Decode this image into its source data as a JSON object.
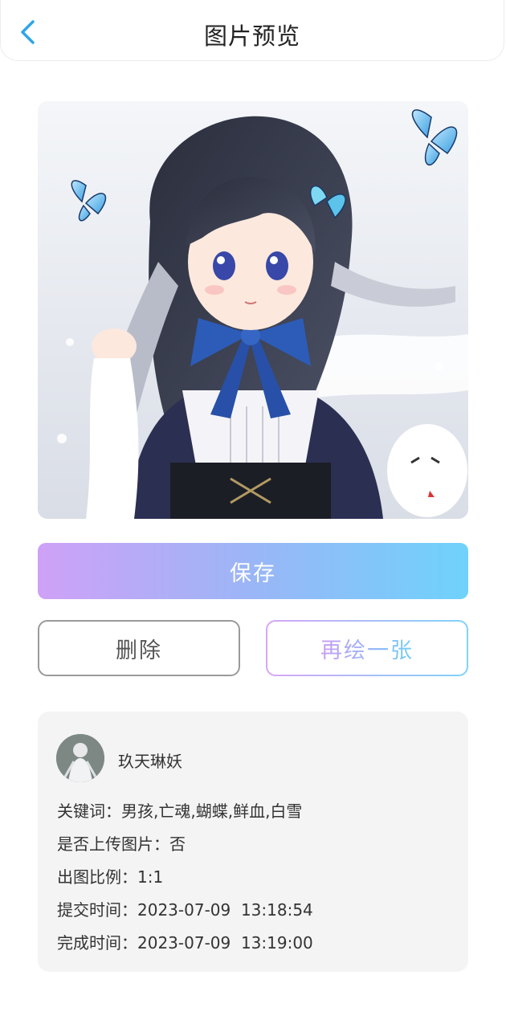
{
  "header": {
    "title": "图片预览"
  },
  "actions": {
    "save_label": "保存",
    "delete_label": "删除",
    "redraw_label": "再绘一张"
  },
  "info": {
    "username": "玖天琳妖",
    "rows": [
      {
        "label": "关键词：",
        "value": "男孩,亡魂,蝴蝶,鲜血,白雪"
      },
      {
        "label": "是否上传图片：",
        "value": "否"
      },
      {
        "label": "出图比例：",
        "value": "1:1"
      },
      {
        "label": "提交时间：",
        "value": "2023-07-09  13:18:54"
      },
      {
        "label": "完成时间：",
        "value": "2023-07-09  13:19:00"
      }
    ]
  },
  "colors": {
    "accent_blue": "#2ea6e6",
    "gradient_start": "#cfa1f7",
    "gradient_end": "#6fd2fb",
    "card_bg": "#f4f4f4"
  },
  "icons": {
    "back": "chevron-left-icon"
  }
}
